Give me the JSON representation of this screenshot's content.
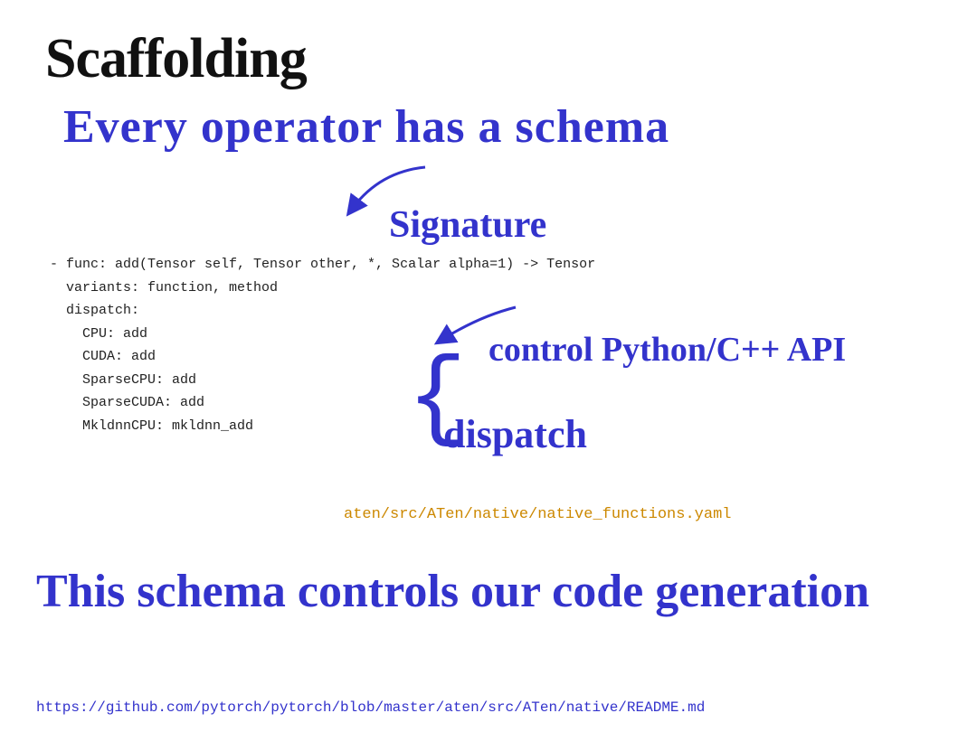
{
  "slide": {
    "title": "Scaffolding",
    "headline": "Every operator  has a  schema",
    "signature_label": "Signature",
    "control_label": "control Python/C++ API",
    "dispatch_label": "dispatch",
    "code_lines": [
      "- func: add(Tensor self, Tensor other, *, Scalar alpha=1) -> Tensor",
      "  variants: function, method",
      "  dispatch:",
      "    CPU: add",
      "    CUDA: add",
      "    SparseCPU: add",
      "    SparseCUDA: add",
      "    MkldnnCPU: mkldnn_add"
    ],
    "yaml_path": "aten/src/ATen/native/native_functions.yaml",
    "bottom_headline": "This schema controls our code generation",
    "footer_link": "https://github.com/pytorch/pytorch/blob/master/aten/src/ATen/native/README.md"
  }
}
